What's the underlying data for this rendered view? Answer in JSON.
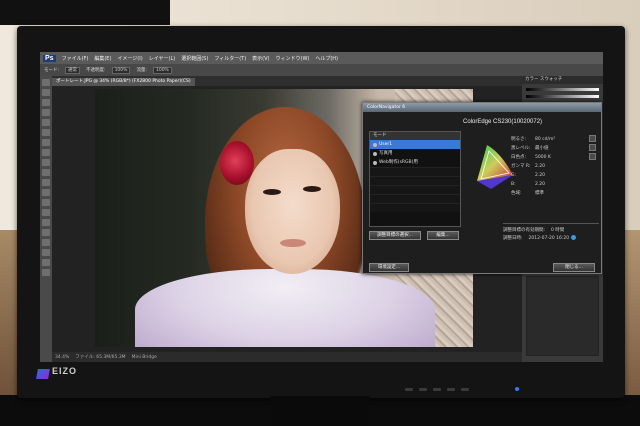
{
  "photoshop": {
    "logo": "Ps",
    "menu": [
      "ファイル(F)",
      "編集(E)",
      "イメージ(I)",
      "レイヤー(L)",
      "選択範囲(S)",
      "フィルター(T)",
      "表示(V)",
      "ウィンドウ(W)",
      "ヘルプ(H)"
    ],
    "options": {
      "mode_label": "モード:",
      "mode_value": "通常",
      "opacity_label": "不透明度:",
      "opacity_value": "100%",
      "flow_label": "流量:",
      "flow_value": "100%"
    },
    "tabs": [
      "ポートレート.JPG @ 34% (RGB/8*) (FX2800 Photo Paper)(CS)"
    ],
    "status": {
      "zoom": "34.4%",
      "doc_size": "ファイル: 65.3M/65.3M",
      "mini_bridge": "Mini Bridge"
    },
    "panels": {
      "color_header": "カラー  スウォッチ"
    }
  },
  "color_navigator": {
    "title": "ColorNavigator 6",
    "model": "ColorEdge CS230(10020072)",
    "list_header": "モード",
    "modes": [
      {
        "label": "User1",
        "selected": true
      },
      {
        "label": "写真用",
        "selected": false
      },
      {
        "label": "Web制作(sRGB)用",
        "selected": false
      }
    ],
    "info_labels": [
      "明るさ:",
      "黒レベル:",
      "白色点:",
      "ガンマ R:",
      "G:",
      "B:",
      "色域:"
    ],
    "info_values": [
      "80 cd/m²",
      "最小値",
      "5000 K",
      "2.20",
      "2.20",
      "2.20",
      "標準"
    ],
    "calib_label_1": "調整目標の有効期間:",
    "calib_value_1": "0 時間",
    "calib_label_2": "調整日時:",
    "calib_value_2": "2012-07-20 16:20",
    "buttons": {
      "color_mode": "調整目標の選択...",
      "edit": "編集...",
      "advanced": "環境設定...",
      "close": "閉じる..."
    }
  },
  "monitor": {
    "brand": "EIZO"
  }
}
